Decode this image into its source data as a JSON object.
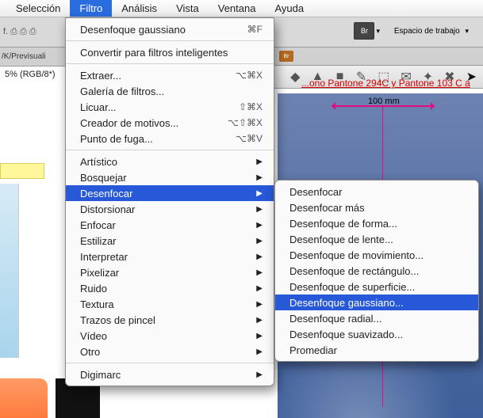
{
  "menubar": {
    "items": [
      "Selección",
      "Filtro",
      "Análisis",
      "Vista",
      "Ventana",
      "Ayuda"
    ],
    "active_index": 1
  },
  "toolbar": {
    "br_label": "Br",
    "workspace_label": "Espacio de trabajo",
    "chev": "▾"
  },
  "tabbar": {
    "text": "f.   ⎙ ⎙ ⎙"
  },
  "tabdoc": {
    "text": "/K/Previsuali"
  },
  "docinfo": "5% (RGB/8*)",
  "redtext": "...ono Pantone 294C y Pantone 103 C a",
  "ruler_label": "100 mm",
  "x_label": "x",
  "filtro_menu": {
    "top": {
      "label": "Desenfoque gaussiano",
      "shortcut": "⌘F"
    },
    "convert": "Convertir para filtros inteligentes",
    "group1": [
      {
        "label": "Extraer...",
        "shortcut": "⌥⌘X"
      },
      {
        "label": "Galería de filtros..."
      },
      {
        "label": "Licuar...",
        "shortcut": "⇧⌘X"
      },
      {
        "label": "Creador de motivos...",
        "shortcut": "⌥⇧⌘X"
      },
      {
        "label": "Punto de fuga...",
        "shortcut": "⌥⌘V"
      }
    ],
    "group2": [
      "Artístico",
      "Bosquejar",
      "Desenfocar",
      "Distorsionar",
      "Enfocar",
      "Estilizar",
      "Interpretar",
      "Pixelizar",
      "Ruido",
      "Textura",
      "Trazos de pincel",
      "Vídeo",
      "Otro"
    ],
    "highlight_index": 2,
    "digimarc": "Digimarc"
  },
  "submenu": {
    "items": [
      "Desenfocar",
      "Desenfocar más",
      "Desenfoque de forma...",
      "Desenfoque de lente...",
      "Desenfoque de movimiento...",
      "Desenfoque de rectángulo...",
      "Desenfoque de superficie...",
      "Desenfoque gaussiano...",
      "Desenfoque radial...",
      "Desenfoque suavizado...",
      "Promediar"
    ],
    "highlight_index": 7
  },
  "icons": {
    "tool_colors": [
      "#3b6fb5",
      "#2a8a3a",
      "#d48b00",
      "#3b6fb5",
      "#3b6fb5",
      "#38a",
      "#d43",
      "#d43",
      "#a33"
    ]
  }
}
